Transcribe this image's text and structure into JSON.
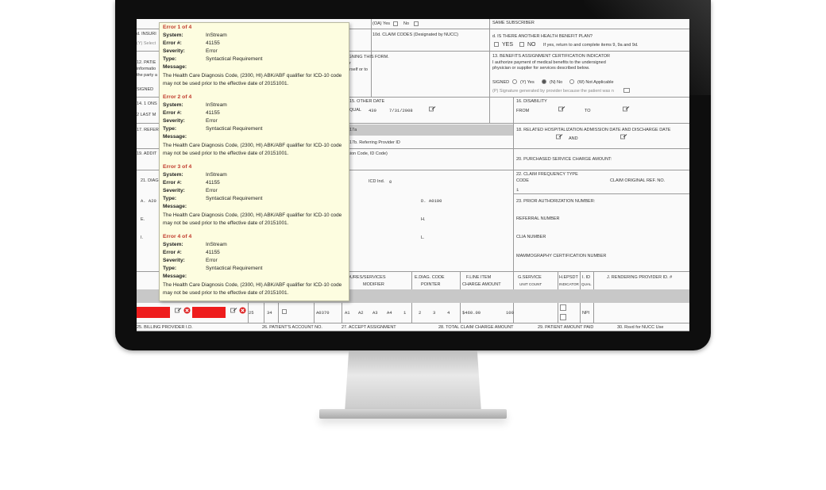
{
  "form": {
    "f10c_yes": "(OA) Yes",
    "f10c_no": "No",
    "f10d": "10d. CLAIM CODES (Designated by NUCC)",
    "f11d": "d. IS THERE ANOTHER HEALTH BENEFIT PLAN?",
    "f11d_yes": "YES",
    "f11d_no": "NO",
    "f11d_note": "If yes, return to and complete items 9, 9a and 9d.",
    "f13": "13. BENEFITS ASSIGNMENT CERTIFICATION INDICATOR I authorize payment of medical benefits to the undersigned physician or supplier for services described below.",
    "signed": "SIGNED",
    "signed_y": "(Y) Yes",
    "signed_n": "(N) No",
    "signed_w": "(W) Not Applicable",
    "signature_note": "(P) Signature generated by provider because the patient was n",
    "left_partial": [
      "d. INSURI",
      "(Y) Select",
      "12. PATIE",
      "informatio",
      "the party a",
      "SIGNED",
      "14. 1 ONS",
      "2 LAST M",
      "17. REFER",
      "19. ADDIT",
      "21. DIAG",
      "A. A20",
      "E.",
      "I."
    ],
    "mid_partial": [
      "IGNING THIS FORM.",
      "or",
      "urself or to",
      "sion Code, ID Code)"
    ],
    "f15": "15. OTHER DATE",
    "f15_qual": "QUAL",
    "f15_qual_val": "439",
    "f15_date": "7/31/2008",
    "f16": "16. DISABILITY",
    "f16_from": "FROM",
    "f16_to": "TO",
    "f17a": "17a",
    "f17b": "17b. Referring Provider ID",
    "f18": "18. RELATED HOSPITALIZATION ADMISSION DATE AND DISCHARGE DATE",
    "f18_and": "AND",
    "f20": "20. PURCHASED SERVICE CHARGE AMOUNT:",
    "f22": "22. CLAIM FREQUENCY TYPE",
    "f22_code": "CODE",
    "f22_code_val": "1",
    "f22_orig": "CLAIM ORIGINAL REF. NO.",
    "icd_ind": "ICD Ind.",
    "icd_ind_val": "0",
    "diag_d": "D. A0100",
    "diag_h": "H.",
    "diag_l": "L.",
    "f23": "23. PRIOR AUTHORIZATION NUMBER:",
    "referral": "REFERRAL NUMBER",
    "clia": "CLIA NUMBER",
    "mammo": "MAMMOGRAPHY CERTIFICATION NUMBER",
    "col_services": "DURES/SERVICES",
    "col_modifier": "MODIFIER",
    "col_diagcode": "E.DIAG. CODE",
    "col_pointer": "POINTER",
    "col_lineitem": "F.LINE ITEM",
    "col_charge": "CHARGE AMOUNT",
    "col_gservice": "G.SERVICE",
    "col_unit": "UNIT COUNT",
    "col_hepsdt": "H.EPSDT",
    "col_indicator": "INDICATOR",
    "col_iid": "I. ID",
    "col_qual": "QUAL",
    "col_rendering": "J. RENDERING PROVIDER ID. #",
    "row_vals": [
      "25",
      "34",
      "",
      "A0370",
      "A1",
      "A2",
      "A3",
      "A4",
      "1",
      "2",
      "3",
      "4",
      "$460.00",
      "100",
      "",
      "NPI"
    ],
    "f25": "25. BILLING PROVIDER I.D.",
    "f26": "26. PATIENT'S ACCOUNT NO.",
    "f27": "27. ACCEPT ASSIGNMENT",
    "f28": "28. TOTAL CLAIM CHARGE AMOUNT",
    "f29": "29. PATIENT AMOUNT PAID",
    "f30": "30. Rsvd for NUCC Use",
    "top_right_partial": "SAME SUBSCRIBER"
  },
  "errors": [
    {
      "title": "Error 1 of 4",
      "system_label": "System:",
      "system": "InStream",
      "num_label": "Error #:",
      "num": "41155",
      "sev_label": "Severity:",
      "severity": "Error",
      "type_label": "Type:",
      "type": "Syntactical Requirement",
      "msg_label": "Message:",
      "message": "The Health Care Diagnosis Code, (2300, HI) ABK/ABF qualifier for ICD-10 code may not be used prior to the effective date of 20151001."
    },
    {
      "title": "Error 2 of 4",
      "system_label": "System:",
      "system": "InStream",
      "num_label": "Error #:",
      "num": "41155",
      "sev_label": "Severity:",
      "severity": "Error",
      "type_label": "Type:",
      "type": "Syntactical Requirement",
      "msg_label": "Message:",
      "message": "The Health Care Diagnosis Code, (2300, HI) ABK/ABF qualifier for ICD-10 code may not be used prior to the effective date of 20151001."
    },
    {
      "title": "Error 3 of 4",
      "system_label": "System:",
      "system": "InStream",
      "num_label": "Error #:",
      "num": "41155",
      "sev_label": "Severity:",
      "severity": "Error",
      "type_label": "Type:",
      "type": "Syntactical Requirement",
      "msg_label": "Message:",
      "message": "The Health Care Diagnosis Code, (2300, HI) ABK/ABF qualifier for ICD-10 code may not be used prior to the effective date of 20151001."
    },
    {
      "title": "Error 4 of 4",
      "system_label": "System:",
      "system": "InStream",
      "num_label": "Error #:",
      "num": "41155",
      "sev_label": "Severity:",
      "severity": "Error",
      "type_label": "Type:",
      "type": "Syntactical Requirement",
      "msg_label": "Message:",
      "message": "The Health Care Diagnosis Code, (2300, HI) ABK/ABF qualifier for ICD-10 code may not be used prior to the effective date of 20151001."
    }
  ],
  "colors": {
    "error_red": "#ee1c1c",
    "tooltip_bg": "#fdfde0",
    "error_title": "#c0392b"
  },
  "icons": [
    "edit-pencil-icon",
    "error-x-icon"
  ]
}
